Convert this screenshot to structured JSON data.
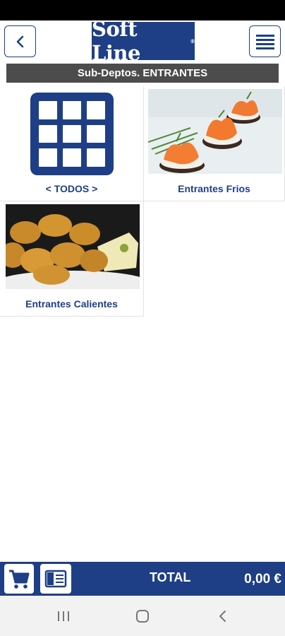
{
  "header": {
    "logo_text": "Soft Line",
    "logo_mark": "®",
    "back_icon": "chevron-left-icon",
    "menu_icon": "hamburger-menu-icon"
  },
  "section": {
    "title": "Sub-Deptos. ENTRANTES"
  },
  "tiles": [
    {
      "label": "< TODOS >",
      "icon": "grid-icon"
    },
    {
      "label": "Entrantes Frios",
      "image": "salmon-canapes-photo"
    },
    {
      "label": "Entrantes Calientes",
      "image": "croquettes-photo"
    }
  ],
  "footer": {
    "cart_icon": "cart-icon",
    "ticket_icon": "ticket-icon",
    "total_label": "TOTAL",
    "total_value": "0,00 €"
  },
  "navbar": {
    "recents_icon": "recents-icon",
    "home_icon": "home-icon",
    "back_icon": "back-icon"
  },
  "colors": {
    "brand": "#1e3f86",
    "section_bar": "#4c4c4c",
    "nav_bar": "#f2f2f2"
  }
}
